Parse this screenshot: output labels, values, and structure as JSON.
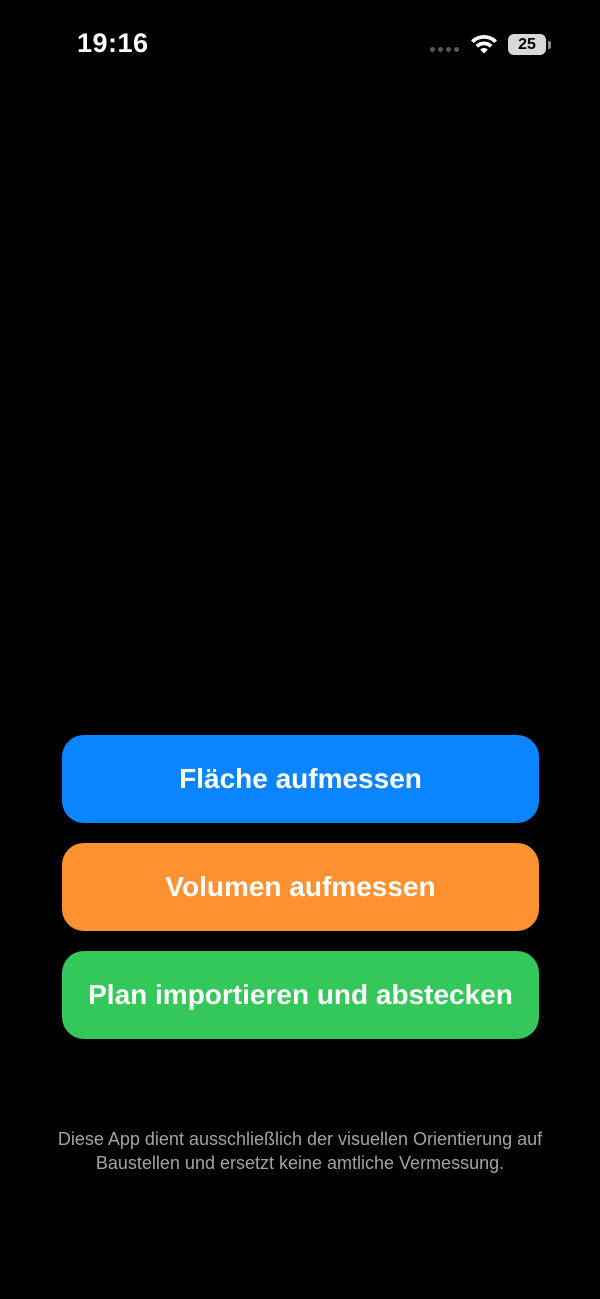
{
  "status_bar": {
    "time": "19:16",
    "battery_level": "25",
    "icons": [
      "signal-dots-icon",
      "wifi-icon",
      "battery-icon"
    ]
  },
  "actions": {
    "measure_area": "Fläche aufmessen",
    "measure_volume": "Volumen aufmessen",
    "import_plan": "Plan importieren und abstecken"
  },
  "colors": {
    "background": "#000000",
    "measure_area_button": "#0a84ff",
    "measure_volume_button": "#ff9230",
    "import_plan_button": "#34c759",
    "disclaimer_text": "#a3a3a3"
  },
  "disclaimer": "Diese App dient ausschließlich der visuellen Orientierung auf Baustellen und ersetzt keine amtliche Vermessung."
}
